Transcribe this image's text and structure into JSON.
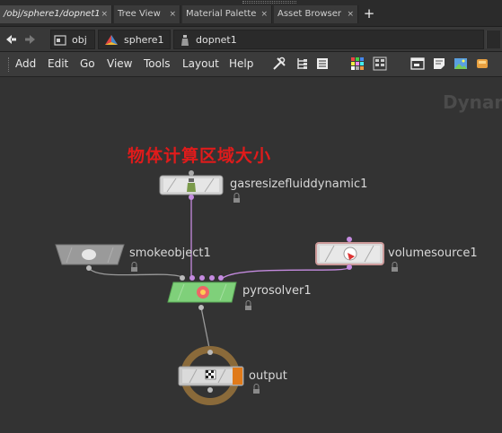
{
  "tabs": [
    {
      "label": "/obj/sphere1/dopnet1",
      "active": true
    },
    {
      "label": "Tree View",
      "active": false
    },
    {
      "label": "Material Palette",
      "active": false
    },
    {
      "label": "Asset Browser",
      "active": false
    }
  ],
  "tab_close_glyph": "×",
  "tab_add_glyph": "+",
  "path": {
    "obj": "obj",
    "sphere": "sphere1",
    "dopnet": "dopnet1"
  },
  "menus": [
    "Add",
    "Edit",
    "Go",
    "View",
    "Tools",
    "Layout",
    "Help"
  ],
  "network": {
    "context_label": "Dynam",
    "annotation": "物体计算区域大小",
    "nodes": {
      "gasresize": "gasresizefluiddynamic1",
      "smokeobject": "smokeobject1",
      "volumesource": "volumesource1",
      "pyrosolver": "pyrosolver1",
      "output": "output"
    }
  },
  "colors": {
    "annotation": "#e01b1b",
    "pyrosolver_node": "#7fd07a",
    "wire": "#c58be0",
    "output_ring": "#8a6a3a"
  }
}
